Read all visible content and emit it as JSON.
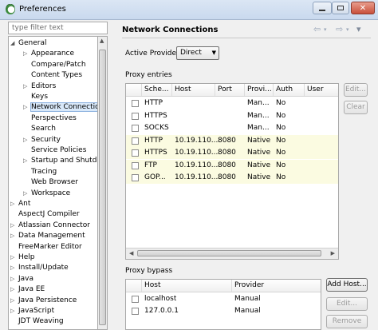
{
  "window": {
    "title": "Preferences"
  },
  "filter": {
    "placeholder": "type filter text"
  },
  "tree": [
    {
      "label": "General",
      "level": 0,
      "arrow": "open"
    },
    {
      "label": "Appearance",
      "level": 1,
      "arrow": "closed"
    },
    {
      "label": "Compare/Patch",
      "level": 1,
      "arrow": ""
    },
    {
      "label": "Content Types",
      "level": 1,
      "arrow": ""
    },
    {
      "label": "Editors",
      "level": 1,
      "arrow": "closed"
    },
    {
      "label": "Keys",
      "level": 1,
      "arrow": ""
    },
    {
      "label": "Network Connection",
      "level": 1,
      "arrow": "closed",
      "selected": true
    },
    {
      "label": "Perspectives",
      "level": 1,
      "arrow": ""
    },
    {
      "label": "Search",
      "level": 1,
      "arrow": ""
    },
    {
      "label": "Security",
      "level": 1,
      "arrow": "closed"
    },
    {
      "label": "Service Policies",
      "level": 1,
      "arrow": ""
    },
    {
      "label": "Startup and Shutdov",
      "level": 1,
      "arrow": "closed"
    },
    {
      "label": "Tracing",
      "level": 1,
      "arrow": ""
    },
    {
      "label": "Web Browser",
      "level": 1,
      "arrow": ""
    },
    {
      "label": "Workspace",
      "level": 1,
      "arrow": "closed"
    },
    {
      "label": "Ant",
      "level": 0,
      "arrow": "closed"
    },
    {
      "label": "AspectJ Compiler",
      "level": 0,
      "arrow": ""
    },
    {
      "label": "Atlassian Connector",
      "level": 0,
      "arrow": "closed"
    },
    {
      "label": "Data Management",
      "level": 0,
      "arrow": "closed"
    },
    {
      "label": "FreeMarker Editor",
      "level": 0,
      "arrow": ""
    },
    {
      "label": "Help",
      "level": 0,
      "arrow": "closed"
    },
    {
      "label": "Install/Update",
      "level": 0,
      "arrow": "closed"
    },
    {
      "label": "Java",
      "level": 0,
      "arrow": "closed"
    },
    {
      "label": "Java EE",
      "level": 0,
      "arrow": "closed"
    },
    {
      "label": "Java Persistence",
      "level": 0,
      "arrow": "closed"
    },
    {
      "label": "JavaScript",
      "level": 0,
      "arrow": "closed"
    },
    {
      "label": "JDT Weaving",
      "level": 0,
      "arrow": ""
    }
  ],
  "page": {
    "title": "Network Connections"
  },
  "active_provider": {
    "label": "Active Provider:",
    "value": "Direct"
  },
  "proxy_entries": {
    "label": "Proxy entries",
    "columns": [
      "Sche...",
      "Host",
      "Port",
      "Provi...",
      "Auth",
      "User"
    ],
    "rows": [
      {
        "scheme": "HTTP",
        "host": "",
        "port": "",
        "provider": "Man...",
        "auth": "No",
        "user": "",
        "highlight": false
      },
      {
        "scheme": "HTTPS",
        "host": "",
        "port": "",
        "provider": "Man...",
        "auth": "No",
        "user": "",
        "highlight": false
      },
      {
        "scheme": "SOCKS",
        "host": "",
        "port": "",
        "provider": "Man...",
        "auth": "No",
        "user": "",
        "highlight": false
      },
      {
        "scheme": "HTTP",
        "host": "10.19.110....",
        "port": "8080",
        "provider": "Native",
        "auth": "No",
        "user": "",
        "highlight": true
      },
      {
        "scheme": "HTTPS",
        "host": "10.19.110....",
        "port": "8080",
        "provider": "Native",
        "auth": "No",
        "user": "",
        "highlight": true
      },
      {
        "scheme": "FTP",
        "host": "10.19.110....",
        "port": "8080",
        "provider": "Native",
        "auth": "No",
        "user": "",
        "highlight": true
      },
      {
        "scheme": "GOP...",
        "host": "10.19.110....",
        "port": "8080",
        "provider": "Native",
        "auth": "No",
        "user": "",
        "highlight": true
      }
    ],
    "edit_label": "Edit...",
    "clear_label": "Clear"
  },
  "proxy_bypass": {
    "label": "Proxy bypass",
    "columns": [
      "Host",
      "Provider"
    ],
    "rows": [
      {
        "host": "localhost",
        "provider": "Manual"
      },
      {
        "host": "127.0.0.1",
        "provider": "Manual"
      }
    ],
    "add_label": "Add Host...",
    "edit_label": "Edit...",
    "remove_label": "Remove"
  }
}
